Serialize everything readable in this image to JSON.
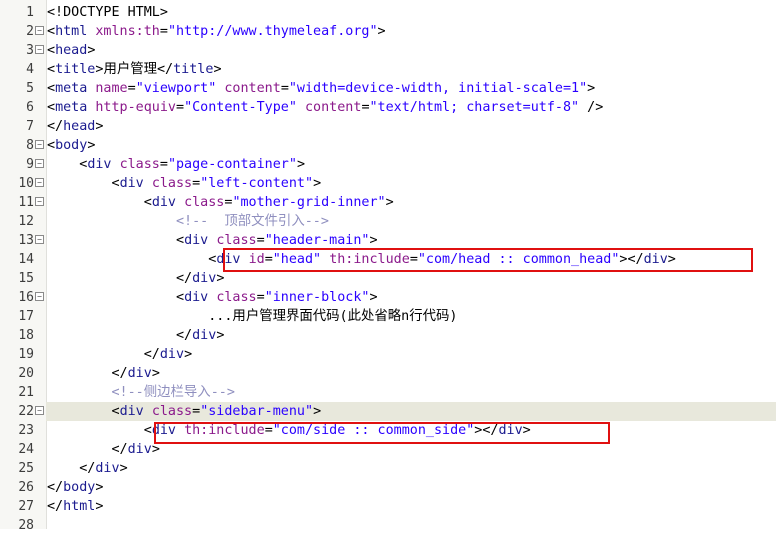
{
  "editor": {
    "lines": [
      {
        "n": "1",
        "fold": "",
        "indent": "",
        "parts": [
          [
            "p",
            "<!DOCTYPE HTML>"
          ]
        ]
      },
      {
        "n": "2",
        "fold": "−",
        "indent": "",
        "parts": [
          [
            "p",
            "<"
          ],
          [
            "t",
            "html"
          ],
          [
            "x",
            " "
          ],
          [
            "a",
            "xmlns:th"
          ],
          [
            "p",
            "="
          ],
          [
            "s",
            "\"http://www.thymeleaf.org\""
          ],
          [
            "p",
            ">"
          ]
        ]
      },
      {
        "n": "3",
        "fold": "−",
        "indent": "",
        "parts": [
          [
            "p",
            "<"
          ],
          [
            "t",
            "head"
          ],
          [
            "p",
            ">"
          ]
        ]
      },
      {
        "n": "4",
        "fold": "",
        "indent": "",
        "parts": [
          [
            "p",
            "<"
          ],
          [
            "t",
            "title"
          ],
          [
            "p",
            ">"
          ],
          [
            "x",
            "用户管理"
          ],
          [
            "p",
            "</"
          ],
          [
            "t",
            "title"
          ],
          [
            "p",
            ">"
          ]
        ]
      },
      {
        "n": "5",
        "fold": "",
        "indent": "",
        "parts": [
          [
            "p",
            "<"
          ],
          [
            "t",
            "meta"
          ],
          [
            "x",
            " "
          ],
          [
            "a",
            "name"
          ],
          [
            "p",
            "="
          ],
          [
            "s",
            "\"viewport\""
          ],
          [
            "x",
            " "
          ],
          [
            "a",
            "content"
          ],
          [
            "p",
            "="
          ],
          [
            "s",
            "\"width=device-width, initial-scale=1\""
          ],
          [
            "p",
            ">"
          ]
        ]
      },
      {
        "n": "6",
        "fold": "",
        "indent": "",
        "parts": [
          [
            "p",
            "<"
          ],
          [
            "t",
            "meta"
          ],
          [
            "x",
            " "
          ],
          [
            "a",
            "http-equiv"
          ],
          [
            "p",
            "="
          ],
          [
            "s",
            "\"Content-Type\""
          ],
          [
            "x",
            " "
          ],
          [
            "a",
            "content"
          ],
          [
            "p",
            "="
          ],
          [
            "s",
            "\"text/html; charset=utf-8\""
          ],
          [
            "x",
            " "
          ],
          [
            "p",
            "/>"
          ]
        ]
      },
      {
        "n": "7",
        "fold": "",
        "indent": "",
        "parts": [
          [
            "p",
            "</"
          ],
          [
            "t",
            "head"
          ],
          [
            "p",
            ">"
          ]
        ]
      },
      {
        "n": "8",
        "fold": "−",
        "indent": "",
        "parts": [
          [
            "p",
            "<"
          ],
          [
            "t",
            "body"
          ],
          [
            "p",
            ">"
          ]
        ]
      },
      {
        "n": "9",
        "fold": "−",
        "indent": "    ",
        "parts": [
          [
            "p",
            "<"
          ],
          [
            "t",
            "div"
          ],
          [
            "x",
            " "
          ],
          [
            "a",
            "class"
          ],
          [
            "p",
            "="
          ],
          [
            "s",
            "\"page-container\""
          ],
          [
            "p",
            ">"
          ]
        ]
      },
      {
        "n": "10",
        "fold": "−",
        "indent": "        ",
        "parts": [
          [
            "p",
            "<"
          ],
          [
            "t",
            "div"
          ],
          [
            "x",
            " "
          ],
          [
            "a",
            "class"
          ],
          [
            "p",
            "="
          ],
          [
            "s",
            "\"left-content\""
          ],
          [
            "p",
            ">"
          ]
        ]
      },
      {
        "n": "11",
        "fold": "−",
        "indent": "            ",
        "parts": [
          [
            "p",
            "<"
          ],
          [
            "t",
            "div"
          ],
          [
            "x",
            " "
          ],
          [
            "a",
            "class"
          ],
          [
            "p",
            "="
          ],
          [
            "s",
            "\"mother-grid-inner\""
          ],
          [
            "p",
            ">"
          ]
        ]
      },
      {
        "n": "12",
        "fold": "",
        "indent": "                ",
        "parts": [
          [
            "c",
            "<!--  顶部文件引入-->"
          ]
        ]
      },
      {
        "n": "13",
        "fold": "−",
        "indent": "                ",
        "parts": [
          [
            "p",
            "<"
          ],
          [
            "t",
            "div"
          ],
          [
            "x",
            " "
          ],
          [
            "a",
            "class"
          ],
          [
            "p",
            "="
          ],
          [
            "s",
            "\"header-main\""
          ],
          [
            "p",
            ">"
          ]
        ]
      },
      {
        "n": "14",
        "fold": "",
        "indent": "                    ",
        "parts": [
          [
            "p",
            "<"
          ],
          [
            "t",
            "div"
          ],
          [
            "x",
            " "
          ],
          [
            "a",
            "id"
          ],
          [
            "p",
            "="
          ],
          [
            "s",
            "\"head\""
          ],
          [
            "x",
            " "
          ],
          [
            "a",
            "th:include"
          ],
          [
            "p",
            "="
          ],
          [
            "s",
            "\"com/head :: common_head\""
          ],
          [
            "p",
            "></"
          ],
          [
            "t",
            "div"
          ],
          [
            "p",
            ">"
          ]
        ]
      },
      {
        "n": "15",
        "fold": "",
        "indent": "                ",
        "parts": [
          [
            "p",
            "</"
          ],
          [
            "t",
            "div"
          ],
          [
            "p",
            ">"
          ]
        ]
      },
      {
        "n": "16",
        "fold": "−",
        "indent": "                ",
        "parts": [
          [
            "p",
            "<"
          ],
          [
            "t",
            "div"
          ],
          [
            "x",
            " "
          ],
          [
            "a",
            "class"
          ],
          [
            "p",
            "="
          ],
          [
            "s",
            "\"inner-block\""
          ],
          [
            "p",
            ">"
          ]
        ]
      },
      {
        "n": "17",
        "fold": "",
        "indent": "                    ",
        "parts": [
          [
            "x",
            "...用户管理界面代码(此处省略n行代码)"
          ]
        ]
      },
      {
        "n": "18",
        "fold": "",
        "indent": "                ",
        "parts": [
          [
            "p",
            "</"
          ],
          [
            "t",
            "div"
          ],
          [
            "p",
            ">"
          ]
        ]
      },
      {
        "n": "19",
        "fold": "",
        "indent": "            ",
        "parts": [
          [
            "p",
            "</"
          ],
          [
            "t",
            "div"
          ],
          [
            "p",
            ">"
          ]
        ]
      },
      {
        "n": "20",
        "fold": "",
        "indent": "        ",
        "parts": [
          [
            "p",
            "</"
          ],
          [
            "t",
            "div"
          ],
          [
            "p",
            ">"
          ]
        ]
      },
      {
        "n": "21",
        "fold": "",
        "indent": "        ",
        "parts": [
          [
            "c",
            "<!--侧边栏导入-->"
          ]
        ]
      },
      {
        "n": "22",
        "fold": "−",
        "indent": "        ",
        "parts": [
          [
            "p",
            "<"
          ],
          [
            "t",
            "div"
          ],
          [
            "x",
            " "
          ],
          [
            "a",
            "class"
          ],
          [
            "p",
            "="
          ],
          [
            "s",
            "\"sidebar-menu\""
          ],
          [
            "p",
            ">"
          ]
        ]
      },
      {
        "n": "23",
        "fold": "",
        "indent": "            ",
        "parts": [
          [
            "p",
            "<"
          ],
          [
            "t",
            "div"
          ],
          [
            "x",
            " "
          ],
          [
            "a",
            "th:include"
          ],
          [
            "p",
            "="
          ],
          [
            "s",
            "\"com/side :: common_side\""
          ],
          [
            "p",
            "></"
          ],
          [
            "t",
            "div"
          ],
          [
            "p",
            ">"
          ]
        ]
      },
      {
        "n": "24",
        "fold": "",
        "indent": "        ",
        "parts": [
          [
            "p",
            "</"
          ],
          [
            "t",
            "div"
          ],
          [
            "p",
            ">"
          ]
        ]
      },
      {
        "n": "25",
        "fold": "",
        "indent": "    ",
        "parts": [
          [
            "p",
            "</"
          ],
          [
            "t",
            "div"
          ],
          [
            "p",
            ">"
          ]
        ]
      },
      {
        "n": "26",
        "fold": "",
        "indent": "",
        "parts": [
          [
            "p",
            "</"
          ],
          [
            "t",
            "body"
          ],
          [
            "p",
            ">"
          ]
        ]
      },
      {
        "n": "27",
        "fold": "",
        "indent": "",
        "parts": [
          [
            "p",
            "</"
          ],
          [
            "t",
            "html"
          ],
          [
            "p",
            ">"
          ]
        ]
      },
      {
        "n": "28",
        "fold": "",
        "indent": "",
        "parts": []
      }
    ],
    "current_line": "22",
    "highlight_color": "#e01010"
  }
}
